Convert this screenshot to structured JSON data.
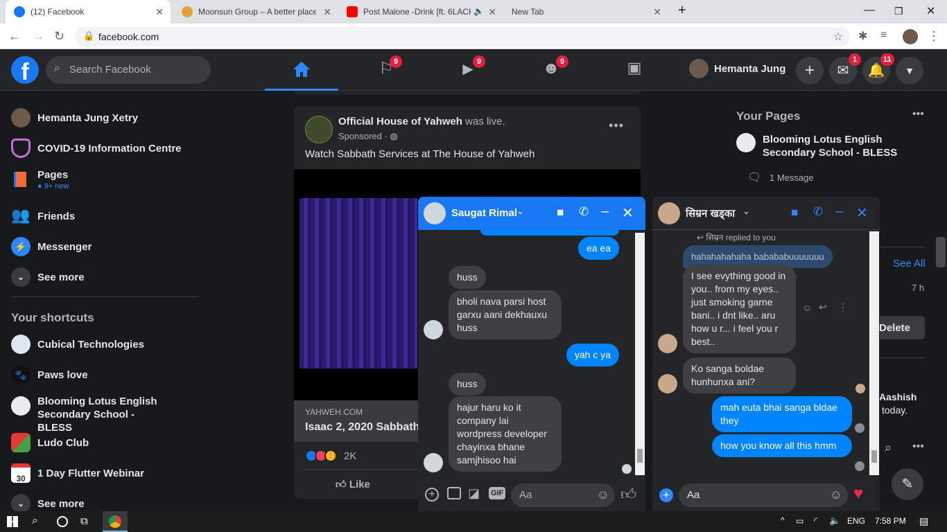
{
  "browser": {
    "tabs": [
      {
        "title": "(12) Facebook",
        "color": "#1877f2"
      },
      {
        "title": "Moonsun Group – A better place",
        "color": "#e8a03b"
      },
      {
        "title": "Post Malone -Drink [ft. 6LACK",
        "color": "#ff0000"
      },
      {
        "title": "New Tab",
        "color": ""
      }
    ],
    "url": "facebook.com"
  },
  "header": {
    "logo": "f",
    "search_placeholder": "Search Facebook",
    "nav_badges": [
      "9",
      "9",
      "9"
    ],
    "user_name": "Hemanta Jung",
    "messenger_badge": "1",
    "notif_badge": "11"
  },
  "left_nav": {
    "items": [
      {
        "label": "Hemanta Jung Xetry",
        "icon": "profile-avatar"
      },
      {
        "label": "COVID-19 Information Centre",
        "icon": "covid-shield-icon"
      },
      {
        "label": "Pages",
        "icon": "pages-flag-icon",
        "sub": "9+ new"
      },
      {
        "label": "Friends",
        "icon": "friends-icon"
      },
      {
        "label": "Messenger",
        "icon": "messenger-icon"
      },
      {
        "label": "See more",
        "icon": "chevron-down-icon"
      }
    ],
    "shortcuts_title": "Your shortcuts",
    "shortcuts": [
      {
        "label": "Cubical Technologies"
      },
      {
        "label": "Paws love"
      },
      {
        "label": "Blooming Lotus English Secondary School - BLESS"
      },
      {
        "label": "Ludo Club"
      },
      {
        "label": "1 Day Flutter Webinar"
      },
      {
        "label": "See more"
      }
    ]
  },
  "post": {
    "author": "Official House of Yahweh",
    "action": "was live.",
    "meta": "Sponsored ·",
    "text": "Watch Sabbath Services at The House of Yahweh",
    "link_domain": "YAHWEH.COM",
    "link_title": "Isaac 2, 2020 Sabbath",
    "reactions_count": "2K",
    "like_label": "Like"
  },
  "right_rail": {
    "your_pages_title": "Your Pages",
    "page_name": "Blooming Lotus English Secondary School - BLESS",
    "messages": "1 Message",
    "see_all": "See All",
    "time": "7 h",
    "delete_label": "Delete",
    "contact_fragment": "Aashish",
    "contact_fragment2": "today."
  },
  "chat1": {
    "name": "Saugat Rimal",
    "messages": [
      {
        "dir": "out",
        "text": "ea ea"
      },
      {
        "dir": "in",
        "text": "huss"
      },
      {
        "dir": "in",
        "text": "bholi nava parsi host garxu aani dekhauxu huss"
      },
      {
        "dir": "out",
        "text": "yah c ya"
      },
      {
        "dir": "in",
        "text": "huss"
      },
      {
        "dir": "in",
        "text": "hajur haru ko it company lai wordpress developer chayinxa bhane samjhisoo hai"
      }
    ],
    "placeholder": "Aa",
    "gif_label": "GIF"
  },
  "chat2": {
    "name": "सिम्रन खड्का",
    "replied_label": "सिम्रन replied to you",
    "messages": [
      {
        "dir": "reply",
        "text": "hahahahahaha babababuuuuuuu"
      },
      {
        "dir": "in",
        "text": "I see evything good in you.. from my eyes.. just smoking garne bani.. i dnt like.. aru how u r... i feel you r best.."
      },
      {
        "dir": "in",
        "text": "Ko sanga boldae hunhunxa ani?"
      },
      {
        "dir": "out",
        "text": "mah euta bhai sanga bldae they"
      },
      {
        "dir": "out",
        "text": "how you know all this hmm"
      }
    ],
    "placeholder": "Aa"
  },
  "taskbar": {
    "lang": "ENG",
    "time": "7:58 PM"
  }
}
